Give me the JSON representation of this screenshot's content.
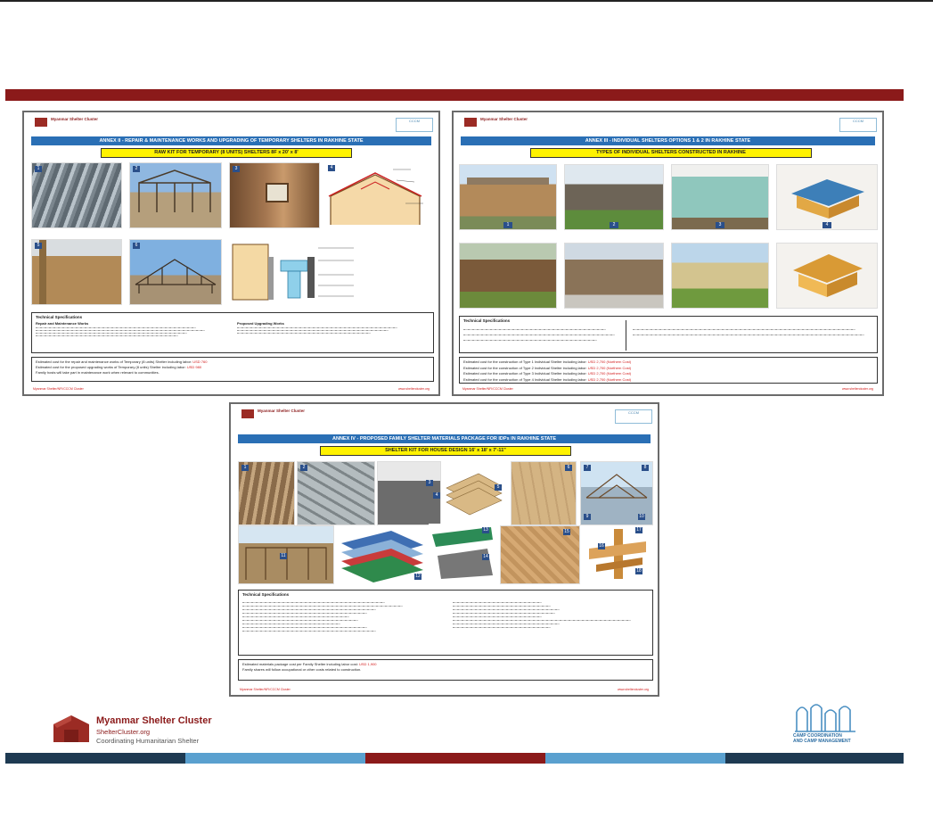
{
  "colors": {
    "maroon": "#8b1a1a",
    "blue": "#2a6fb5",
    "yellow": "#fff200",
    "navy": "#1e3a52",
    "light_blue": "#5aa0cf"
  },
  "sheet1": {
    "org": "Myanmar Shelter Cluster",
    "header": "ANNEX II - REPAIR & MAINTENANCE WORKS AND UPGRADING OF TEMPORARY SHELTERS IN RAKHINE STATE",
    "subheader": "RAW KIT FOR TEMPORARY (8 UNITS) SHELTERS 8F x 20' x 8'",
    "badges": [
      "1",
      "2",
      "3",
      "4",
      "5",
      "6",
      "7",
      "8"
    ],
    "spec_title": "Technical Specifications",
    "left_spec_title": "Repair and Maintenance Works",
    "right_spec_title": "Proposed Upgrading Works",
    "cost_line1": "Estimated cost for the repair and maintenance works of Temporary (8 units) Shelter including labor:",
    "cost_line2": "Estimated cost for the proposed upgrading works of Temporary (8 units) Shelter including labor:",
    "cost_line3": "Family hosts will take part in maintenance work when relevant to communities.",
    "cost_value1": "USD 760",
    "cost_value2": "USD 980",
    "footer_left": "Myanmar Shelter/NFI/CCCM Cluster",
    "footer_right": "www.sheltercluster.org"
  },
  "sheet2": {
    "org": "Myanmar Shelter Cluster",
    "header": "ANNEX III - INDIVIDUAL SHELTERS OPTIONS 1 & 2 IN RAKHINE STATE",
    "subheader": "TYPES OF INDIVIDUAL SHELTERS CONSTRUCTED IN RAKHINE",
    "badges": [
      "1",
      "2",
      "3",
      "4"
    ],
    "spec_title": "Technical Specifications",
    "cost_line1": "Estimated cost for the construction of Type 1 Individual Shelter including labor:",
    "cost_line2": "Estimated cost for the construction of Type 2 Individual Shelter including labor:",
    "cost_line3": "Estimated cost for the construction of Type 3 Individual Shelter including labor:",
    "cost_line4": "Estimated cost for the construction of Type 4 Individual Shelter including labor:",
    "cost_value": "USD 2,700 (Northern Cost)",
    "footer_left": "Myanmar Shelter/NFI/CCCM Cluster",
    "footer_right": "www.sheltercluster.org"
  },
  "sheet3": {
    "org": "Myanmar Shelter Cluster",
    "header": "ANNEX IV - PROPOSED FAMILY SHELTER MATERIALS PACKAGE FOR IDPs IN RAKHINE STATE",
    "subheader": "SHELTER KIT FOR HOUSE DESIGN 16' x 18' x 7'-11\"",
    "badges": [
      "1",
      "2",
      "3",
      "4",
      "5",
      "6",
      "7",
      "8",
      "9",
      "10",
      "11",
      "12",
      "13",
      "14",
      "15",
      "16",
      "17",
      "18"
    ],
    "spec_title": "Technical Specifications",
    "cost_line1": "Estimated materials package cost per Family Shelter including labor cost:",
    "cost_value": "USD 1,900",
    "cost_line2": "Family shares will follow occupational or other costs related to construction.",
    "footer_left": "Myanmar Shelter/NFI/CCCM Cluster",
    "footer_right": "www.sheltercluster.org"
  },
  "footer": {
    "cluster_name": "Myanmar Shelter Cluster",
    "cluster_url": "ShelterCluster.org",
    "cluster_tagline": "Coordinating Humanitarian Shelter",
    "cccm_line1": "CAMP COORDINATION",
    "cccm_line2": "AND CAMP MANAGEMENT"
  }
}
